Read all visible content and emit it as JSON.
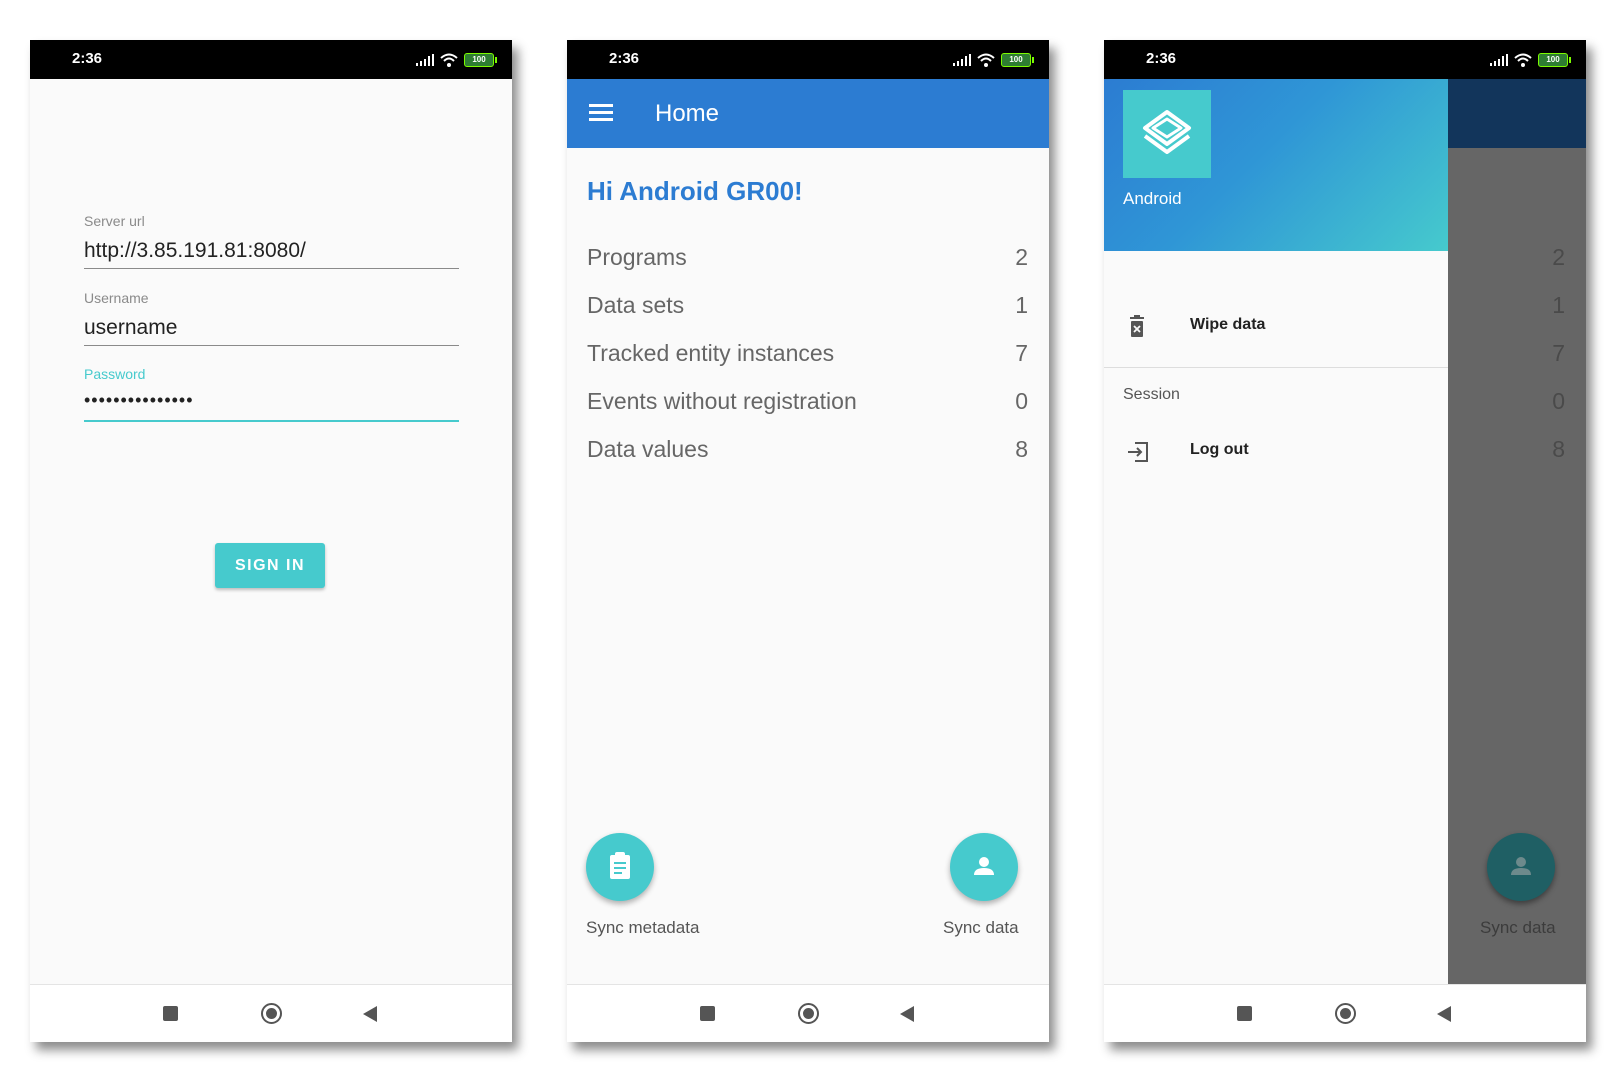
{
  "status_bar": {
    "time": "2:36",
    "battery": "100"
  },
  "login": {
    "server_url_label": "Server url",
    "server_url_value": "http://3.85.191.81:8080/",
    "username_label": "Username",
    "username_value": "username",
    "password_label": "Password",
    "password_value": "•••••••••••••••",
    "sign_in_label": "SIGN IN",
    "accent_color": "#46cacd"
  },
  "home": {
    "title": "Home",
    "greeting": "Hi Android GR00!",
    "stats": [
      {
        "label": "Programs",
        "value": "2"
      },
      {
        "label": "Data sets",
        "value": "1"
      },
      {
        "label": "Tracked entity instances",
        "value": "7"
      },
      {
        "label": "Events without registration",
        "value": "0"
      },
      {
        "label": "Data values",
        "value": "8"
      }
    ],
    "sync_metadata_label": "Sync metadata",
    "sync_data_label": "Sync data",
    "sync_metadata_icon": "clipboard-icon",
    "sync_data_icon": "person-icon",
    "primary_color": "#2c7cd2"
  },
  "drawer": {
    "user_name": "Android",
    "logo_icon": "layers-icon",
    "wipe_data_label": "Wipe data",
    "wipe_icon": "trash-icon",
    "session_label": "Session",
    "log_out_label": "Log out",
    "logout_icon": "logout-icon",
    "background_values": [
      "2",
      "1",
      "7",
      "0",
      "8"
    ],
    "sync_data_label": "Sync data"
  }
}
